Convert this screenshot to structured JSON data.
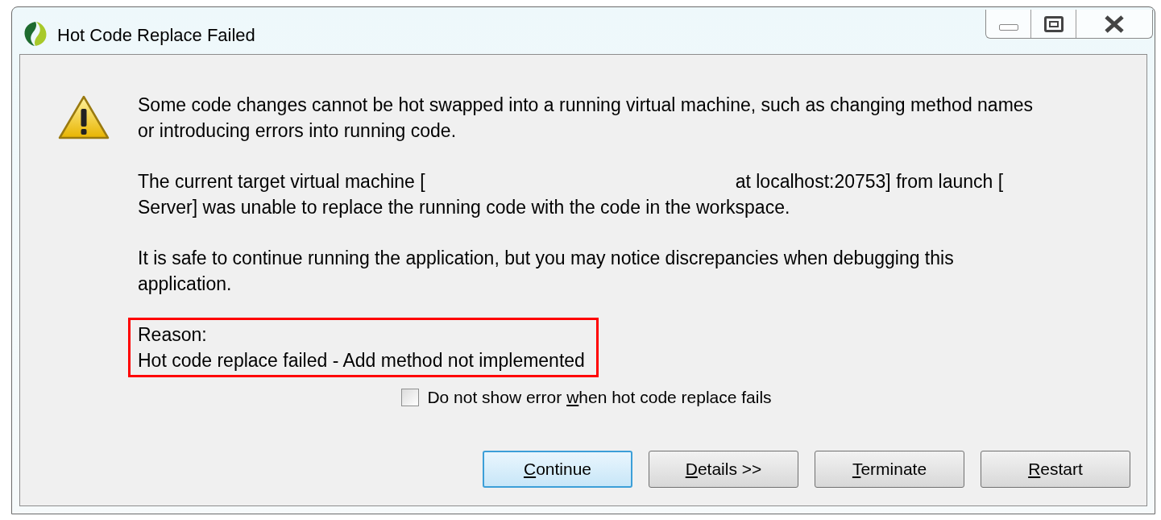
{
  "window": {
    "title": "Hot Code Replace Failed"
  },
  "message": [
    {
      "kind": "lines",
      "lines": [
        "Some code changes cannot be hot swapped into a running virtual machine, such as changing method names",
        "or introducing errors into running code."
      ]
    },
    {
      "kind": "gap",
      "first": [
        "The current target virtual machine [",
        "at localhost:20753] from launch ["
      ],
      "lines": [
        "Server] was unable to replace the running code with the code in the workspace."
      ]
    },
    {
      "kind": "lines",
      "lines": [
        "It is safe to continue running the application, but you may notice discrepancies when debugging this",
        "application."
      ]
    }
  ],
  "reason": {
    "highlighted": true,
    "lines": [
      "Reason:",
      "Hot code replace failed - Add method not implemented"
    ]
  },
  "checkbox": {
    "label": {
      "before": "Do not show error ",
      "key": "w",
      "after": "hen hot code replace fails"
    },
    "checked": false
  },
  "buttons": [
    {
      "label": {
        "key": "C",
        "after": "ontinue"
      },
      "default": true
    },
    {
      "label": {
        "key": "D",
        "after": "etails >>"
      },
      "default": false
    },
    {
      "label": {
        "key": "T",
        "after": "erminate"
      },
      "default": false
    },
    {
      "label": {
        "key": "R",
        "after": "estart"
      },
      "default": false
    }
  ]
}
